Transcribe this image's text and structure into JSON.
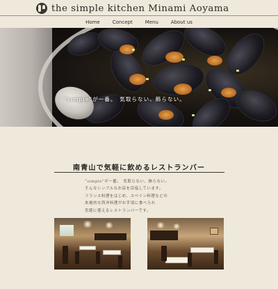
{
  "header": {
    "brand": "the simple kitchen Minami Aoyama",
    "logo_icon": "fork-spoon-logo-icon"
  },
  "nav": {
    "items": [
      "Home",
      "Concept",
      "Menu",
      "About us"
    ]
  },
  "hero": {
    "caption": "“simple”が一番。　気取らない、飾らない。"
  },
  "intro": {
    "title": "南青山で気軽に飲めるレストランバー",
    "lines": [
      "“simple”が一番。　気取らない、飾らない。",
      "そんなシンプルなお店を目指しています。",
      "フランス料理をはじめ、スペイン料理などの",
      "本格的な西洋料理がお手頃に食べられ",
      "気軽に使えるレストランバーです。"
    ]
  },
  "colors": {
    "background": "#efe9dc",
    "text": "#2d2a25",
    "muted_text": "#6a6355"
  }
}
